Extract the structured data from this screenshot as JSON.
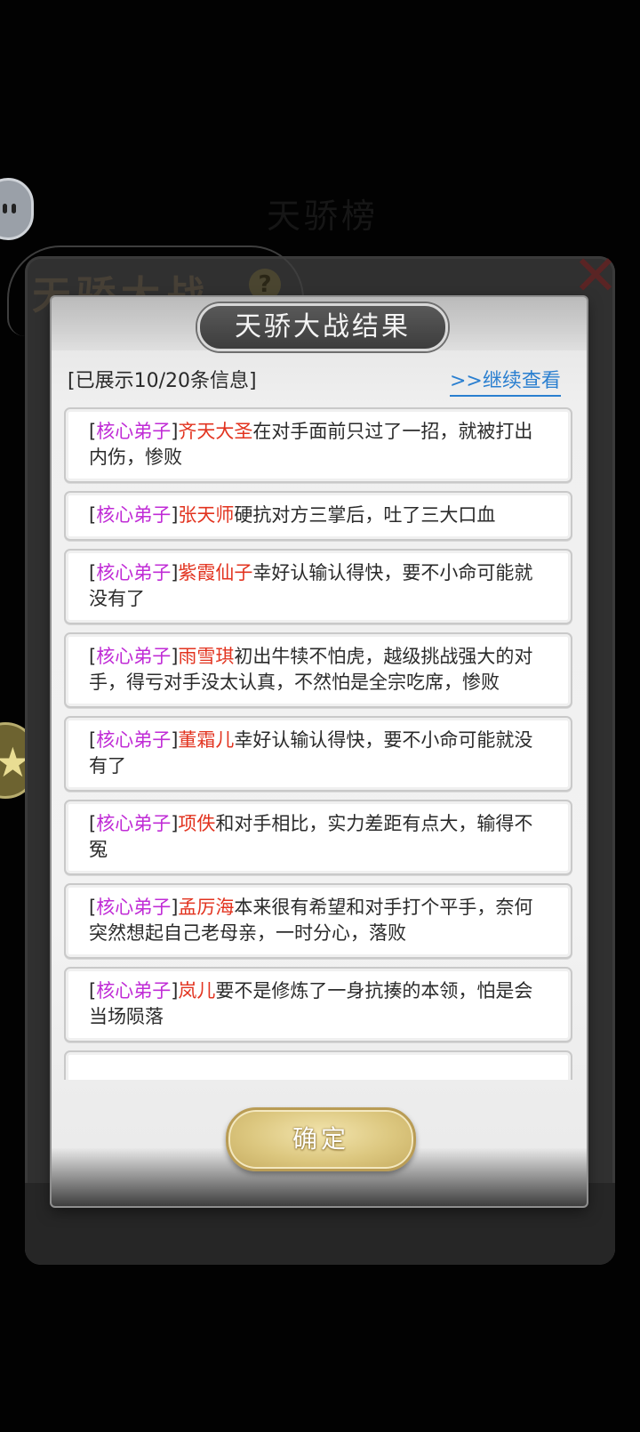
{
  "background": {
    "title_faint": "天骄榜"
  },
  "outer_panel": {
    "title": "天骄大战",
    "help_glyph": "?",
    "close_glyph": "✕"
  },
  "dialog": {
    "title": "天骄大战结果",
    "shown_count": "[已展示10/20条信息]",
    "continue_link": ">>继续查看",
    "entries": [
      {
        "tag": "核心弟子",
        "name": "齐天大圣",
        "text": "在对手面前只过了一招，就被打出内伤，惨败"
      },
      {
        "tag": "核心弟子",
        "name": "张天师",
        "text": "硬抗对方三掌后，吐了三大口血"
      },
      {
        "tag": "核心弟子",
        "name": "紫霞仙子",
        "text": "幸好认输认得快，要不小命可能就没有了"
      },
      {
        "tag": "核心弟子",
        "name": "雨雪琪",
        "text": "初出牛犊不怕虎，越级挑战强大的对手，得亏对手没太认真，不然怕是全宗吃席，惨败"
      },
      {
        "tag": "核心弟子",
        "name": "董霜儿",
        "text": "幸好认输认得快，要不小命可能就没有了"
      },
      {
        "tag": "核心弟子",
        "name": "项佚",
        "text": "和对手相比，实力差距有点大，输得不冤"
      },
      {
        "tag": "核心弟子",
        "name": "孟厉海",
        "text": "本来很有希望和对手打个平手，奈何突然想起自己老母亲，一时分心，落败"
      },
      {
        "tag": "核心弟子",
        "name": "岚儿",
        "text": "要不是修炼了一身抗揍的本领，怕是会当场陨落"
      }
    ],
    "ok_button": "确定"
  },
  "colors": {
    "tag": "#c02cd6",
    "name": "#e2331f",
    "link": "#2a7fd0",
    "button": "#dcc77f"
  },
  "icons": [
    "help-icon",
    "close-icon",
    "chat-bubble-icon",
    "star-icon"
  ]
}
